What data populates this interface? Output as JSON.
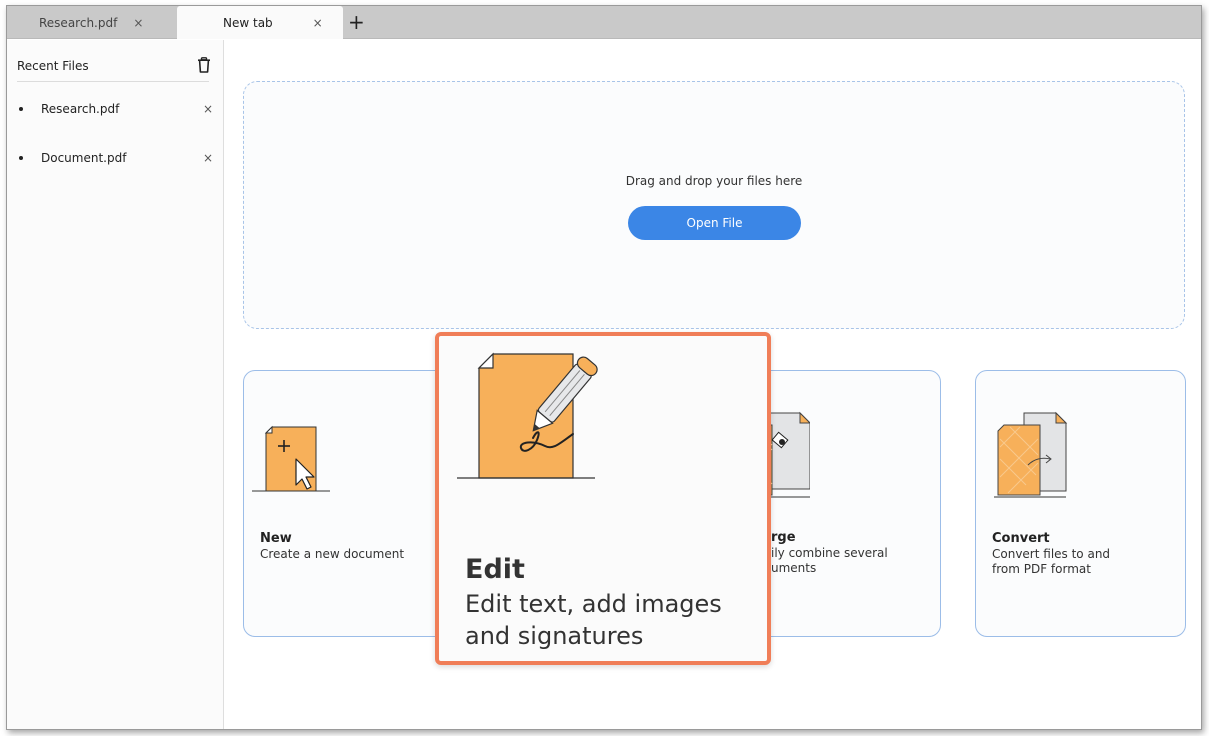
{
  "tabs": [
    {
      "label": "Research.pdf",
      "close": "×"
    },
    {
      "label": "New tab",
      "close": "×"
    }
  ],
  "new_tab_symbol": "+",
  "sidebar": {
    "title": "Recent Files",
    "items": [
      {
        "name": "Research.pdf",
        "remove": "×"
      },
      {
        "name": "Document.pdf",
        "remove": "×"
      }
    ]
  },
  "dropzone": {
    "text": "Drag and drop your files here",
    "button_label": "Open File"
  },
  "cards": {
    "new": {
      "title": "New",
      "desc": "Create a new document"
    },
    "merge": {
      "title": "rge",
      "desc_line1": "ily combine several",
      "desc_line2": "uments"
    },
    "convert": {
      "title": "Convert",
      "desc_line1": "Convert files to and",
      "desc_line2": "from PDF format"
    }
  },
  "edit_popup": {
    "title": "Edit",
    "desc_line1": "Edit text, add images",
    "desc_line2": "and signatures"
  },
  "colors": {
    "accent": "#3b86e6",
    "highlight": "#f07e58",
    "doc_orange": "#f7b05a"
  }
}
